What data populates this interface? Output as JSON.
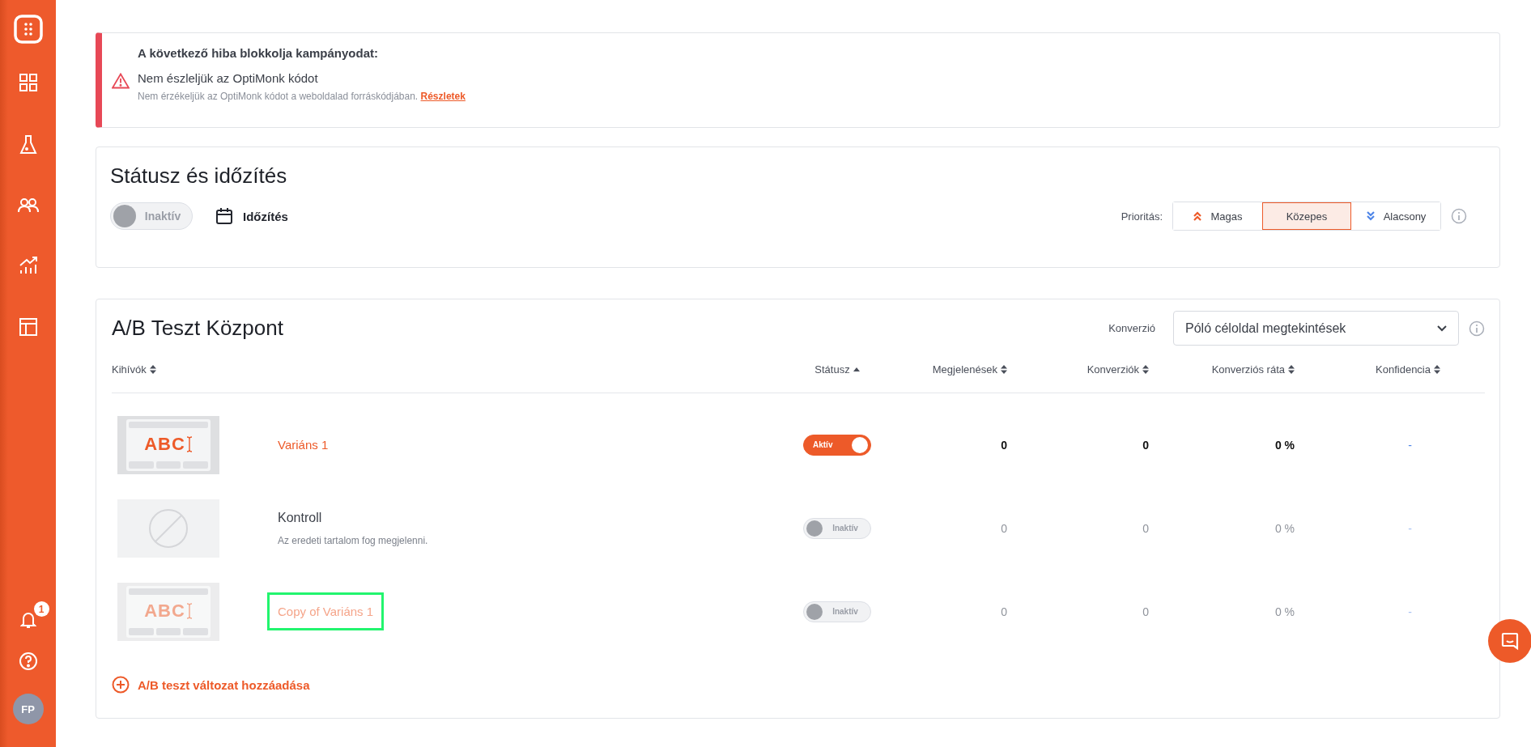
{
  "sidebar": {
    "notification_count": "1",
    "avatar_initials": "FP"
  },
  "alert": {
    "title": "A következő hiba blokkolja kampányodat:",
    "message": "Nem észleljük az OptiMonk kódot",
    "detail": "Nem érzékeljük az OptiMonk kódot a weboldalad forráskódjában.",
    "link": "Részletek"
  },
  "status_section": {
    "title": "Státusz és időzítés",
    "toggle": {
      "label": "Inaktív",
      "on": false
    },
    "schedule_label": "Időzítés",
    "priority": {
      "label": "Prioritás:",
      "options": [
        {
          "label": "Magas",
          "kind": "high",
          "selected": false
        },
        {
          "label": "Közepes",
          "kind": "medium",
          "selected": true
        },
        {
          "label": "Alacsony",
          "kind": "low",
          "selected": false
        }
      ]
    }
  },
  "ab_test": {
    "title": "A/B Teszt Központ",
    "conversion": {
      "label": "Konverzió",
      "value": "Póló céloldal megtekintések"
    },
    "columns": [
      {
        "label": "Kihívók",
        "sorted": false
      },
      {
        "label": "Státusz",
        "sorted": true
      },
      {
        "label": "Megjelenések",
        "sorted": false
      },
      {
        "label": "Konverziók",
        "sorted": false
      },
      {
        "label": "Konverziós ráta",
        "sorted": false
      },
      {
        "label": "Konfidencia",
        "sorted": false
      }
    ],
    "rows": [
      {
        "kind": "variant",
        "thumbnail_text": "ABC",
        "name": "Variáns 1",
        "highlighted": false,
        "status": {
          "label": "Aktív",
          "on": true
        },
        "impressions": "0",
        "conversions": "0",
        "rate": "0 %",
        "confidence": "-"
      },
      {
        "kind": "control",
        "name": "Kontroll",
        "description": "Az eredeti tartalom fog megjelenni.",
        "highlighted": false,
        "status": {
          "label": "Inaktív",
          "on": false
        },
        "impressions": "0",
        "conversions": "0",
        "rate": "0 %",
        "confidence": "-"
      },
      {
        "kind": "variant",
        "thumbnail_text": "ABC",
        "name": "Copy of Variáns 1",
        "highlighted": true,
        "status": {
          "label": "Inaktív",
          "on": false
        },
        "impressions": "0",
        "conversions": "0",
        "rate": "0 %",
        "confidence": "-"
      }
    ],
    "add_button": "A/B teszt változat hozzáadása"
  }
}
